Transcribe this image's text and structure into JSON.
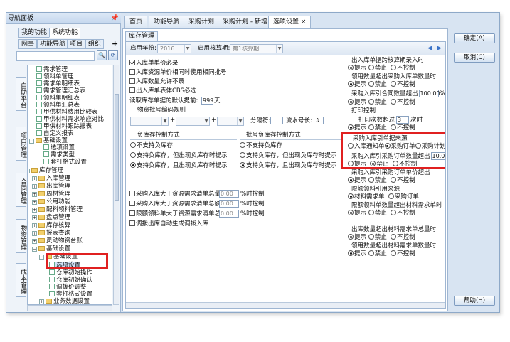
{
  "nav": {
    "title": "导航面板",
    "tabs": [
      "我的功能",
      "系统功能"
    ],
    "subtabs": [
      "网事",
      "功能导航",
      "项目",
      "组织"
    ],
    "plus": "+",
    "side_tabs": [
      "自助平台",
      "项目管理",
      "合同管理",
      "物资管理",
      "成本管理"
    ],
    "tree": [
      "需求管理",
      "领料单管理",
      "需求单明细表",
      "需求管理汇总表",
      "领料单明细表",
      "领料单汇总表",
      "甲供材料费用比较表",
      "甲供材料需求响应对比",
      "甲供材料跟踪报表",
      "自定义报表",
      "基础设置",
      "选项设置",
      "需求类型",
      "套打格式设置",
      "库存管理",
      "入库管理",
      "出库管理",
      "周材管理",
      "公用功能",
      "配料领料管理",
      "盘点管理",
      "库存核算",
      "报表查询",
      "灵动物资台账",
      "基础设置",
      "基础设置",
      "选项设置",
      "仓库初始操作",
      "仓库初始确认",
      "调拨价调整",
      "套打格式设置",
      "业务数据设置"
    ]
  },
  "doctabs": [
    "首页",
    "功能导航",
    "采购计划",
    "采购计划 - 新增",
    "选项设置 ×"
  ],
  "subtab": "库存管理",
  "year_bar": {
    "year_label": "启用年份:",
    "year_value": "2016",
    "period_label": "启用核算期:",
    "period_value": "第1核算期"
  },
  "left_opts": {
    "c1": "入库单单价必录",
    "c2": "入库资源单价相同时使用相同批号",
    "c3": "入库数量允许不录",
    "c4": "出入库单表体CBS必选",
    "days_label": "读取库存单据的默认提前:",
    "days_value": "999",
    "days_unit": "天",
    "batch_label": "物资批号编码规则",
    "sep_label": "分隔符:",
    "serial_label": "流水号长:",
    "neg_title": "负库存控制方式",
    "neg1": "不支持负库存",
    "neg2": "支持负库存，但出现负库存时提示",
    "neg3": "支持负库存，且出现负库存时提示",
    "lot_title": "批号负库存控制方式",
    "lot1": "不支持负库存",
    "lot2": "支持负库存，但出现负库存时提示",
    "lot3": "支持负库存，且出现负库存时提示",
    "r1": "采购入库大于资源需求清单总量",
    "r2": "采购入库大于资源需求清单总额",
    "r3": "限额领料单大于资源需求清单总量",
    "r_val": "0.00",
    "r_unit": "%时控制",
    "r4": "调拨出库自动生成调拨入库"
  },
  "right_opts": {
    "g1": "出入库单据跨核算期录入时",
    "g2": "领用数量超出采购入库单数量时",
    "g3": "采购入库引合同数量超出",
    "g3_val": "100.00",
    "g3_suffix": "%时",
    "g4": "打印控制",
    "g4_sub": "打印次数超过",
    "g4_val": "3",
    "g4_unit": "次时",
    "g5": "采购入库引单据来源",
    "g5_a": "入库通知单",
    "g5_b": "采购订单",
    "g5_c": "采购计划",
    "g6": "采购入库引采购订单数量超出",
    "g6_val": "10.0",
    "g7": "采购入库引采购订单单价超出",
    "g8": "限额领料引用来源",
    "g8_a": "材料需求单",
    "g8_b": "采购订单",
    "g9": "限额领料单数量超出材料需求单时",
    "g10": "出库数量超出材料需求单总量时",
    "g11": "领用数量超出材料需求单数量时",
    "tip": "提示",
    "ban": "禁止",
    "noctl": "不控制"
  },
  "buttons": {
    "ok": "确定(A)",
    "cancel": "取消(C)",
    "help": "帮助(H)"
  }
}
